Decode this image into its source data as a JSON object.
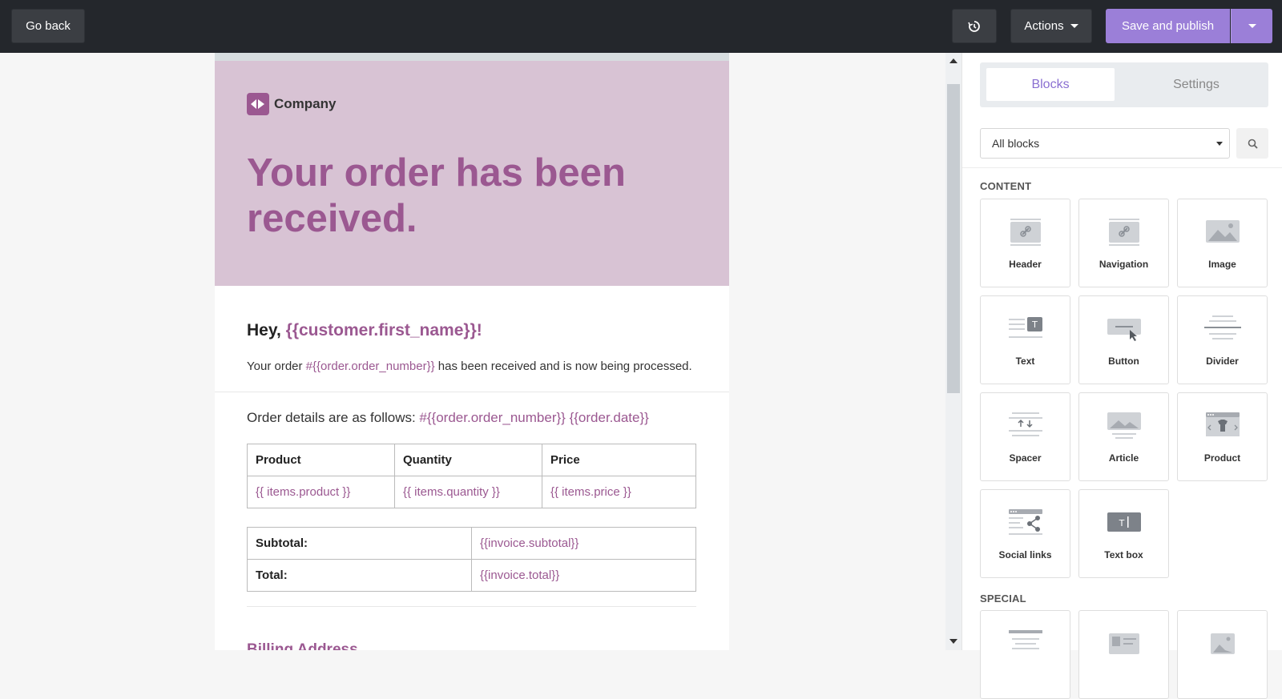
{
  "topbar": {
    "go_back": "Go back",
    "actions": "Actions",
    "save_publish": "Save and publish"
  },
  "email": {
    "logo_text": "Company",
    "hero_title": "Your order has been received.",
    "greeting_prefix": "Hey, ",
    "greeting_var": "{{customer.first_name}}!",
    "order_prefix": "Your order ",
    "order_var": "#{{order.order_number}}",
    "order_suffix": " has been received and is now being processed.",
    "details_prefix": "Order details are as follows: ",
    "details_var": "#{{order.order_number}} {{order.date}}",
    "items_table": {
      "headers": [
        "Product",
        "Quantity",
        "Price"
      ],
      "row": [
        "{{ items.product }}",
        "{{ items.quantity }}",
        "{{ items.price }}"
      ]
    },
    "totals_table": {
      "subtotal_label": "Subtotal:",
      "subtotal_value": "{{invoice.subtotal}}",
      "total_label": "Total:",
      "total_value": "{{invoice.total}}"
    },
    "billing_heading": "Billing Address"
  },
  "panel": {
    "tabs": [
      "Blocks",
      "Settings"
    ],
    "filter_value": "All blocks",
    "section_content": "CONTENT",
    "section_special": "SPECIAL",
    "blocks": [
      "Header",
      "Navigation",
      "Image",
      "Text",
      "Button",
      "Divider",
      "Spacer",
      "Article",
      "Product",
      "Social links",
      "Text box"
    ]
  },
  "colors": {
    "accent": "#9b7fd8",
    "brand": "#9b5891",
    "hero_bg": "#d8c3d4",
    "topbar": "#24272c"
  }
}
